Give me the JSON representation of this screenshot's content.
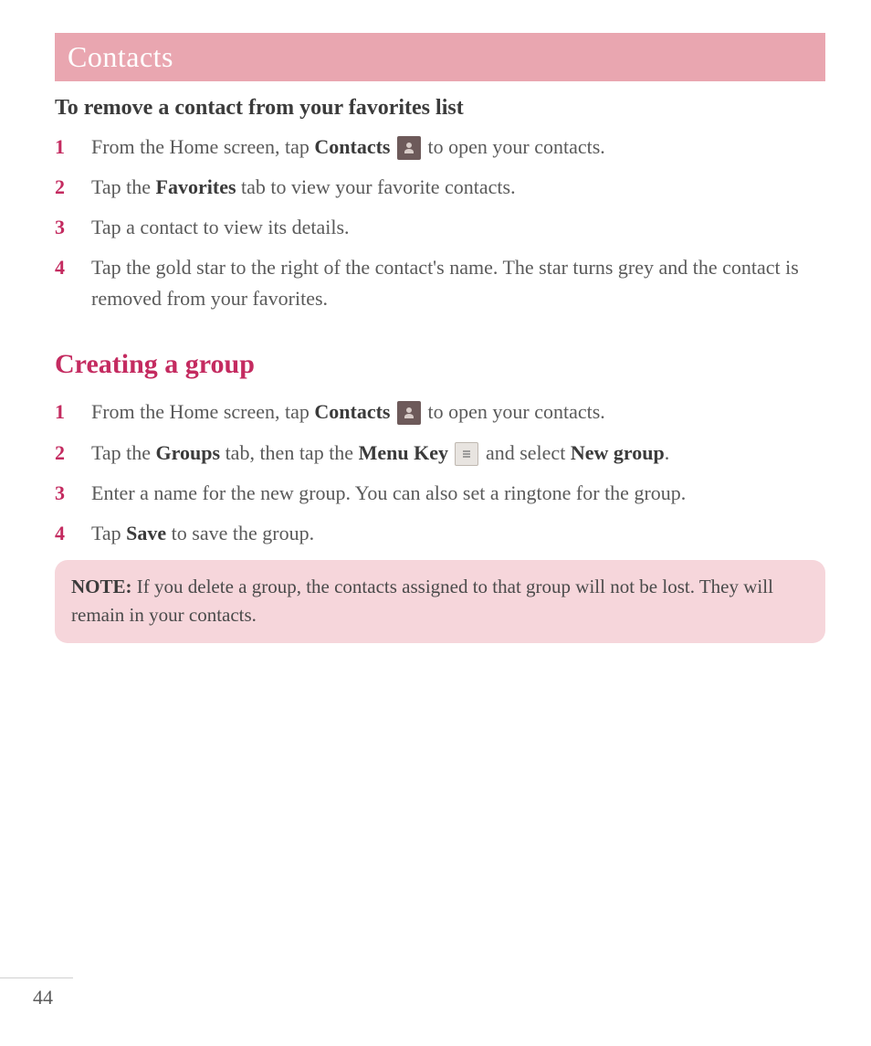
{
  "header": {
    "title": "Contacts"
  },
  "remove": {
    "heading": "To remove a contact from your favorites list",
    "steps": {
      "1": {
        "num": "1",
        "a": "From the Home screen, tap ",
        "b": "Contacts",
        "c": " to open your contacts."
      },
      "2": {
        "num": "2",
        "a": "Tap the ",
        "b": "Favorites",
        "c": " tab to view your favorite contacts."
      },
      "3": {
        "num": "3",
        "a": "Tap a contact to view its details."
      },
      "4": {
        "num": "4",
        "a": "Tap the gold star to the right of the contact's name. The star turns grey and the contact is removed from your favorites."
      }
    }
  },
  "create": {
    "heading": "Creating a group",
    "steps": {
      "1": {
        "num": "1",
        "a": "From the Home screen, tap ",
        "b": "Contacts",
        "c": " to open your contacts."
      },
      "2": {
        "num": "2",
        "a": "Tap the ",
        "b": "Groups",
        "c": " tab, then tap the ",
        "d": "Menu Key",
        "e": " and select ",
        "f": "New group",
        "g": "."
      },
      "3": {
        "num": "3",
        "a": "Enter a name for the new group. You can also set a ringtone for the group."
      },
      "4": {
        "num": "4",
        "a": "Tap ",
        "b": "Save",
        "c": " to save the group."
      }
    }
  },
  "note": {
    "label": "NOTE:",
    "text": " If you delete a group, the contacts assigned to that group will not be lost. They will remain in your contacts."
  },
  "page_number": "44"
}
